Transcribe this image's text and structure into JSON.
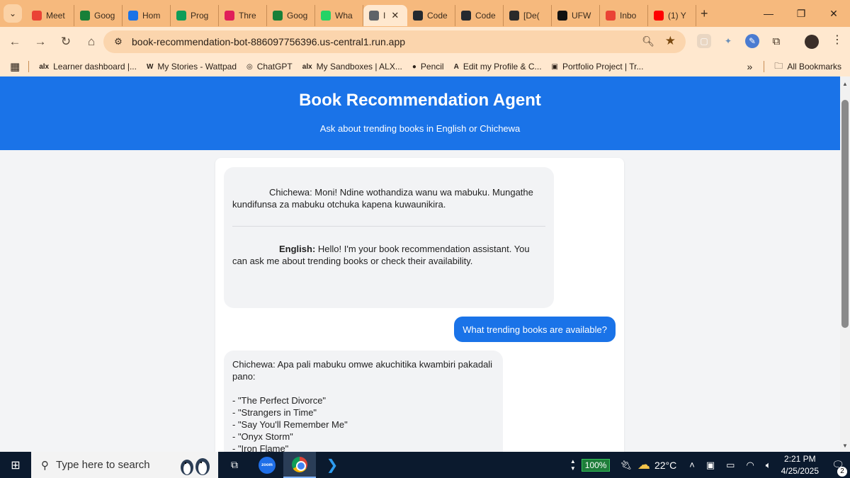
{
  "browser": {
    "tabs": [
      {
        "label": "Meet",
        "icon": "gmail-icon",
        "color": "#ea4335"
      },
      {
        "label": "Goog",
        "icon": "classroom-icon",
        "color": "#188038"
      },
      {
        "label": "Hom",
        "icon": "drive-icon",
        "color": "#1a73e8"
      },
      {
        "label": "Prog",
        "icon": "sheets-icon",
        "color": "#0f9d58"
      },
      {
        "label": "Thre",
        "icon": "slack-icon",
        "color": "#e01e5a"
      },
      {
        "label": "Goog",
        "icon": "classroom-icon",
        "color": "#188038"
      },
      {
        "label": "Wha",
        "icon": "whatsapp-icon",
        "color": "#25d366"
      },
      {
        "label": "I",
        "icon": "globe-icon",
        "color": "#5f6368",
        "active": true
      },
      {
        "label": "Code",
        "icon": "github-icon",
        "color": "#24292f"
      },
      {
        "label": "Code",
        "icon": "github-icon",
        "color": "#24292f"
      },
      {
        "label": "[De(",
        "icon": "puzzle-icon",
        "color": "#2a2a2a"
      },
      {
        "label": "UFW",
        "icon": "chatgpt-icon",
        "color": "#111111"
      },
      {
        "label": "Inbo",
        "icon": "gmail-icon",
        "color": "#ea4335"
      },
      {
        "label": "(1) Y",
        "icon": "youtube-icon",
        "color": "#ff0000"
      }
    ],
    "url": "book-recommendation-bot-886097756396.us-central1.run.app",
    "bookmarks": [
      {
        "label": "Learner dashboard |...",
        "icon": "alx-icon",
        "fav": "alx"
      },
      {
        "label": "My Stories - Wattpad",
        "icon": "wattpad-icon",
        "fav": "W"
      },
      {
        "label": "ChatGPT",
        "icon": "chatgpt-icon",
        "fav": "◎"
      },
      {
        "label": "My Sandboxes | ALX...",
        "icon": "alx-icon",
        "fav": "alx"
      },
      {
        "label": "Pencil",
        "icon": "pencil-icon",
        "fav": "●"
      },
      {
        "label": "Edit my Profile & C...",
        "icon": "letter-a-icon",
        "fav": "A"
      },
      {
        "label": "Portfolio Project | Tr...",
        "icon": "trello-icon",
        "fav": "▣"
      }
    ],
    "all_bookmarks": "All Bookmarks"
  },
  "page": {
    "title": "Book Recommendation Agent",
    "subtitle": "Ask about trending books in English or Chichewa",
    "messages": {
      "bot1_chichewa": "Chichewa: Moni! Ndine wothandiza wanu wa mabuku. Mungathe kundifunsa za mabuku otchuka kapena kuwaunikira.",
      "bot1_english_label": "English:",
      "bot1_english_text": " Hello! I'm your book recommendation assistant. You can ask me about trending books or check their availability.",
      "user1": "What trending books are available?",
      "bot2_intro": "Chichewa: Apa pali mabuku omwe akuchitika kwambiri pakadali pano:",
      "bot2_books": [
        "- \"The Perfect Divorce\"",
        "- \"Strangers in Time\"",
        "- \"Say You'll Remember Me\"",
        "- \"Onyx Storm\"",
        "- \"Iron Flame\""
      ]
    }
  },
  "taskbar": {
    "search_placeholder": "Type here to search",
    "zoom_label": "zoom",
    "battery": "100%",
    "temperature": "22°C",
    "time": "2:21 PM",
    "date": "4/25/2025",
    "notifications": "2"
  }
}
